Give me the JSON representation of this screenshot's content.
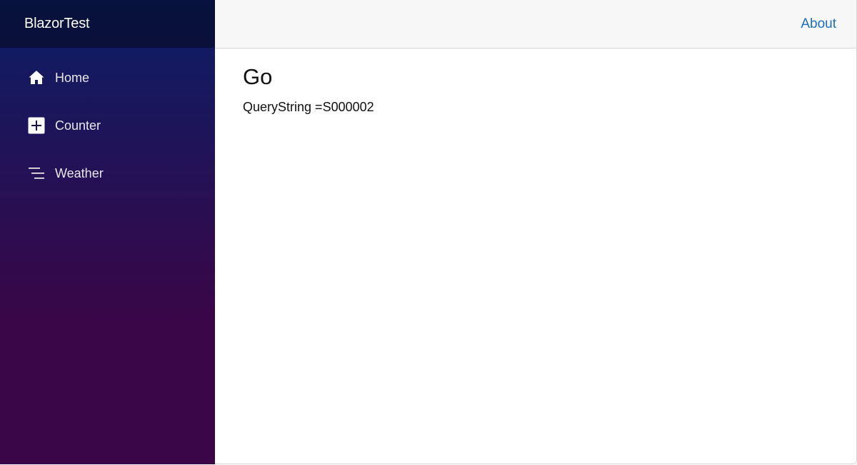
{
  "sidebar": {
    "brand": "BlazorTest",
    "items": [
      {
        "label": "Home",
        "icon": "home-icon"
      },
      {
        "label": "Counter",
        "icon": "plus-square-icon"
      },
      {
        "label": "Weather",
        "icon": "list-icon"
      }
    ]
  },
  "header": {
    "about_label": "About"
  },
  "main": {
    "title": "Go",
    "query_label": "QueryString =",
    "query_value": "S000002"
  },
  "colors": {
    "sidebar_top": "#0b1e66",
    "sidebar_bottom": "#3a0647",
    "link": "#1b6ec2"
  }
}
